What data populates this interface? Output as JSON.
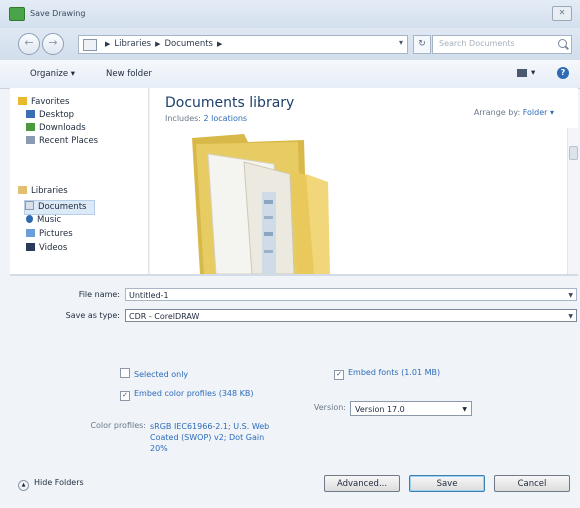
{
  "window": {
    "title": "Save Drawing",
    "close_label": "✕"
  },
  "address": {
    "crumbs": [
      "Libraries",
      "Documents"
    ],
    "search_placeholder": "Search Documents"
  },
  "toolbar": {
    "organize_label": "Organize ▾",
    "new_folder_label": "New folder",
    "views_label": "▾",
    "help_label": "?"
  },
  "nav": {
    "favorites_label": "Favorites",
    "favorites": [
      "Desktop",
      "Downloads",
      "Recent Places"
    ],
    "libraries_label": "Libraries",
    "libraries": [
      "Documents",
      "Music",
      "Pictures",
      "Videos"
    ]
  },
  "library": {
    "title": "Documents library",
    "includes_prefix": "Includes:",
    "includes_link": "2 locations",
    "arrange_prefix": "Arrange by:",
    "arrange_value": "Folder ▾"
  },
  "form": {
    "file_name_label": "File name:",
    "file_name_value": "Untitled-1",
    "save_as_type_label": "Save as type:",
    "save_as_type_value": "CDR - CorelDRAW"
  },
  "options": {
    "selected_only_label": "Selected only",
    "embed_color_label": "Embed color profiles (348 KB)",
    "embed_fonts_label": "Embed fonts (1.01 MB)",
    "version_label": "Version:",
    "version_value": "Version 17.0",
    "color_profiles_label": "Color profiles:",
    "color_profiles_value": "sRGB IEC61966-2.1; U.S. Web Coated (SWOP) v2; Dot Gain 20%"
  },
  "buttons": {
    "advanced_label": "Advanced...",
    "save_label": "Save",
    "cancel_label": "Cancel",
    "hide_folders_label": "Hide Folders"
  },
  "checks": {
    "selected_only": false,
    "embed_color": true,
    "embed_fonts": true
  }
}
